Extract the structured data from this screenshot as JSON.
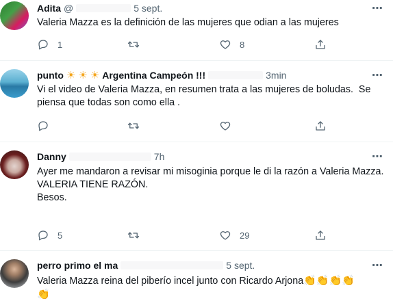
{
  "tweets": [
    {
      "name": "Adita",
      "handle": "@",
      "time": "5 sept.",
      "text": "Valeria Mazza es la definición de las mujeres que odian a las mujeres",
      "replies": "1",
      "retweets": "",
      "likes": "8",
      "avatar_color": "#2e7d32"
    },
    {
      "name": "punto",
      "name_suffix": "Argentina Campeón !!!",
      "time": "3min",
      "text": "Vi el video de Valeria Mazza, en resumen trata a las mujeres de boludas.  Se piensa que todas son como ella .",
      "replies": "",
      "retweets": "",
      "likes": "",
      "avatar_color": "#3f8fb3"
    },
    {
      "name": "Danny",
      "time": "7h",
      "text": "Ayer me mandaron a revisar mi misoginia porque le di la razón a Valeria Mazza.\nVALERIA TIENE RAZÓN.\nBesos.",
      "replies": "5",
      "retweets": "",
      "likes": "29",
      "avatar_color": "#7a2b2b"
    },
    {
      "name": "perro primo el ma",
      "time": "5 sept.",
      "text": "Valeria Mazza reina del piberío incel junto con Ricardo Arjona",
      "replies": "",
      "retweets": "",
      "likes": "",
      "avatar_color": "#9aa3ab"
    }
  ],
  "icons": {
    "more": "more-icon",
    "reply": "reply-icon",
    "retweet": "retweet-icon",
    "like": "heart-icon",
    "share": "share-icon"
  },
  "colors": {
    "text": "#0f1419",
    "secondary": "#536471",
    "divider": "#eff3f4",
    "sun_emoji": "#f4a51c",
    "clap_emoji": "#f6c343"
  },
  "emoji": {
    "sun": "☀",
    "clap": "👏"
  }
}
